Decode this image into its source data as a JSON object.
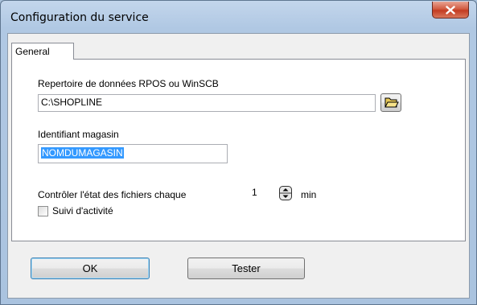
{
  "window": {
    "title": "Configuration du service",
    "close_icon": "close-icon",
    "colors": {
      "frame": "#aac3df",
      "close": "#c33c22",
      "selection": "#3399ff"
    }
  },
  "tabs": [
    {
      "label": "General",
      "selected": true
    }
  ],
  "general": {
    "repertoire_label": "Repertoire de données RPOS ou WinSCB",
    "repertoire_value": "C:\\SHOPLINE",
    "browse_icon": "folder-open-icon",
    "identifiant_label": "Identifiant magasin",
    "identifiant_value": "NOMDUMAGASIN",
    "controle_label": "Contrôler l'état des fichiers chaque",
    "controle_value": "1",
    "controle_unit": "min",
    "suivi_label": "Suivi d'activité",
    "suivi_checked": false
  },
  "buttons": {
    "ok_label": "OK",
    "tester_label": "Tester"
  }
}
